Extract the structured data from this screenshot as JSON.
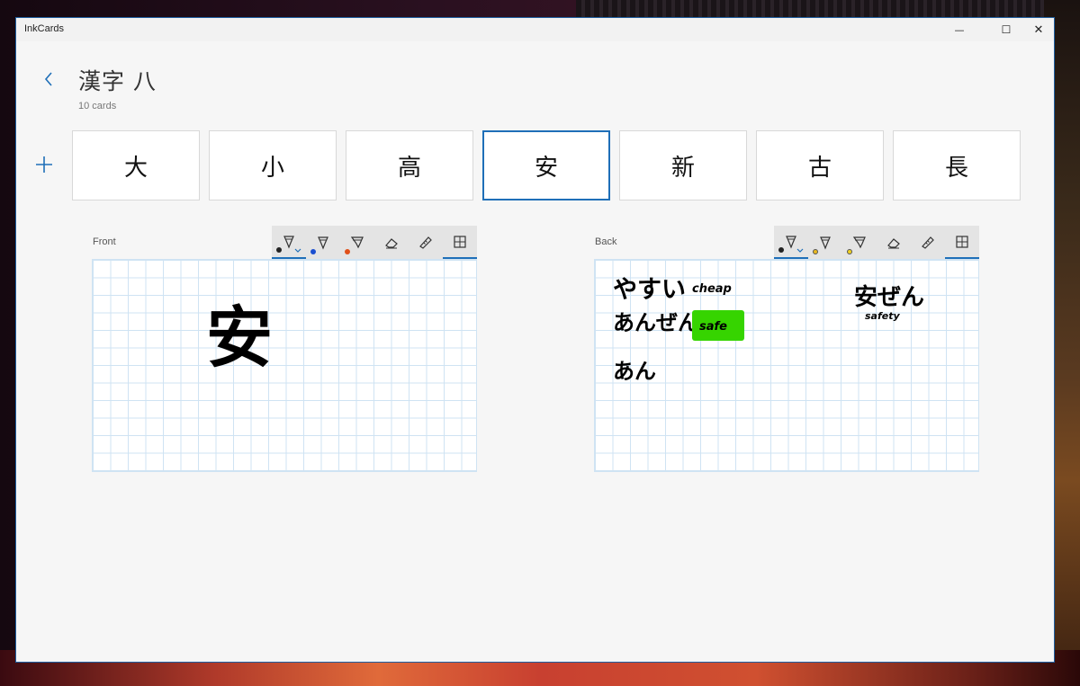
{
  "app": {
    "title": "InkCards"
  },
  "window_controls": {
    "minimize": "—",
    "maximize": "☐",
    "close": "✕"
  },
  "header": {
    "title": "漢字 八",
    "subtitle": "10 cards"
  },
  "icons": {
    "back": "chevron-left-icon",
    "add": "plus-icon",
    "pen": "pen-icon",
    "highlighter": "highlighter-icon",
    "eraser": "eraser-icon",
    "ruler": "ruler-icon",
    "grid": "grid-icon"
  },
  "cards": [
    {
      "char": "大"
    },
    {
      "char": "小"
    },
    {
      "char": "高"
    },
    {
      "char": "安",
      "selected": true
    },
    {
      "char": "新"
    },
    {
      "char": "古"
    },
    {
      "char": "長"
    }
  ],
  "front": {
    "label": "Front",
    "pen_colors": [
      "#222222",
      "#1a4fd0",
      "#e0501a"
    ],
    "ink_text": "安"
  },
  "back": {
    "label": "Back",
    "pen_colors": [
      "#222222",
      "#e8b820",
      "#f0d020"
    ],
    "lines": [
      {
        "jp": "やすい",
        "en": "cheap"
      },
      {
        "jp": "あんぜん",
        "en": "safe",
        "highlight": "#36d400"
      },
      {
        "jp": "あん"
      }
    ],
    "note_jp": "安ぜん",
    "note_en": "safety"
  }
}
